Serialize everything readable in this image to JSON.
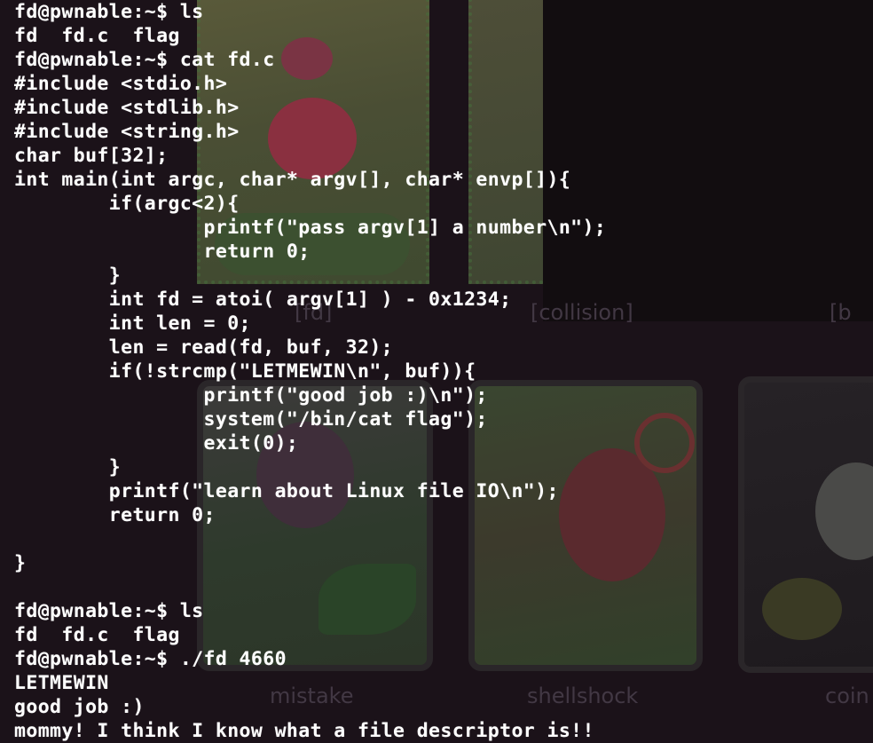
{
  "background": {
    "base_color": "#1b1219",
    "top_cards": [
      {
        "name": "fd",
        "label": "[fd]"
      },
      {
        "name": "collision",
        "label": "[collision]"
      },
      {
        "name": "bof",
        "label": "[b"
      }
    ],
    "bottom_cards": [
      {
        "name": "mistake",
        "label": "mistake"
      },
      {
        "name": "shellshock",
        "label": "shellshock"
      },
      {
        "name": "coin",
        "label": "coin"
      }
    ]
  },
  "terminal": {
    "text_color": "#ffffff",
    "lines": [
      "fd@pwnable:~$ ls",
      "fd  fd.c  flag",
      "fd@pwnable:~$ cat fd.c",
      "#include <stdio.h>",
      "#include <stdlib.h>",
      "#include <string.h>",
      "char buf[32];",
      "int main(int argc, char* argv[], char* envp[]){",
      "        if(argc<2){",
      "                printf(\"pass argv[1] a number\\n\");",
      "                return 0;",
      "        }",
      "        int fd = atoi( argv[1] ) - 0x1234;",
      "        int len = 0;",
      "        len = read(fd, buf, 32);",
      "        if(!strcmp(\"LETMEWIN\\n\", buf)){",
      "                printf(\"good job :)\\n\");",
      "                system(\"/bin/cat flag\");",
      "                exit(0);",
      "        }",
      "        printf(\"learn about Linux file IO\\n\");",
      "        return 0;",
      "",
      "}",
      "",
      "fd@pwnable:~$ ls",
      "fd  fd.c  flag",
      "fd@pwnable:~$ ./fd 4660",
      "LETMEWIN",
      "good job :)",
      "mommy! I think I know what a file descriptor is!!"
    ]
  }
}
